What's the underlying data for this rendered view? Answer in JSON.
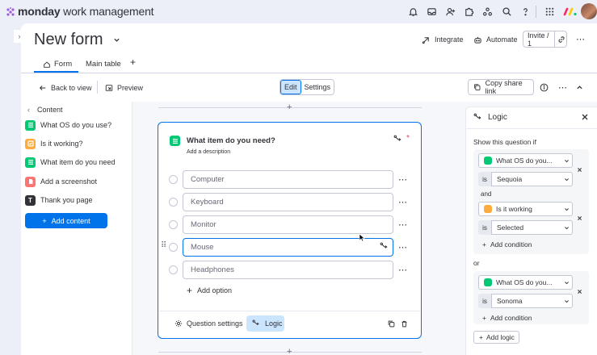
{
  "topbar": {
    "brand_bold": "monday",
    "brand_rest": " work management"
  },
  "header": {
    "title": "New form",
    "integrate": "Integrate",
    "automate": "Automate",
    "invite": "Invite / 1"
  },
  "tabs": [
    {
      "label": "Form",
      "icon": "home-icon",
      "active": true
    },
    {
      "label": "Main table",
      "icon": "",
      "active": false
    }
  ],
  "toolbar": {
    "back": "Back to view",
    "preview": "Preview",
    "edit": "Edit",
    "settings": "Settings",
    "copy_share": "Copy share link"
  },
  "left_panel": {
    "heading": "Content",
    "items": [
      {
        "label": "What OS do you use?",
        "icon": "list-icon",
        "color": "#00c875"
      },
      {
        "label": "Is it working?",
        "icon": "checkbox-icon",
        "color": "#fdab3d"
      },
      {
        "label": "What item do you need",
        "icon": "list-icon",
        "color": "#00c875"
      },
      {
        "label": "Add a screenshot",
        "icon": "file-icon",
        "color": "#fb7575"
      },
      {
        "label": "Thank you page",
        "icon": "t-icon",
        "color": "#323338"
      }
    ],
    "add_content": "Add content"
  },
  "question": {
    "title": "What item do you need?",
    "description": "Add a description",
    "required_mark": "*",
    "options": [
      "Computer",
      "Keyboard",
      "Monitor",
      "Mouse",
      "Headphones"
    ],
    "add_option": "Add option",
    "question_settings": "Question settings",
    "logic": "Logic"
  },
  "logic_panel": {
    "title": "Logic",
    "show_if": "Show this question if",
    "groups": [
      {
        "conditions": [
          {
            "question": "What OS do you...",
            "question_color": "#00c875",
            "is": "is",
            "value": "Sequoia"
          },
          {
            "question": "Is it working",
            "question_color": "#fdab3d",
            "is": "is",
            "value": "Selected"
          }
        ],
        "joiner": "and",
        "add_condition": "Add condition"
      },
      {
        "conditions": [
          {
            "question": "What OS do you...",
            "question_color": "#00c875",
            "is": "is",
            "value": "Sonoma"
          }
        ],
        "add_condition": "Add condition"
      }
    ],
    "or_label": "or",
    "add_logic": "Add logic"
  },
  "colors": {
    "accent": "#0073ea",
    "accent_light": "#cce5ff",
    "green": "#00c875",
    "orange": "#fdab3d",
    "red": "#fb7575"
  }
}
